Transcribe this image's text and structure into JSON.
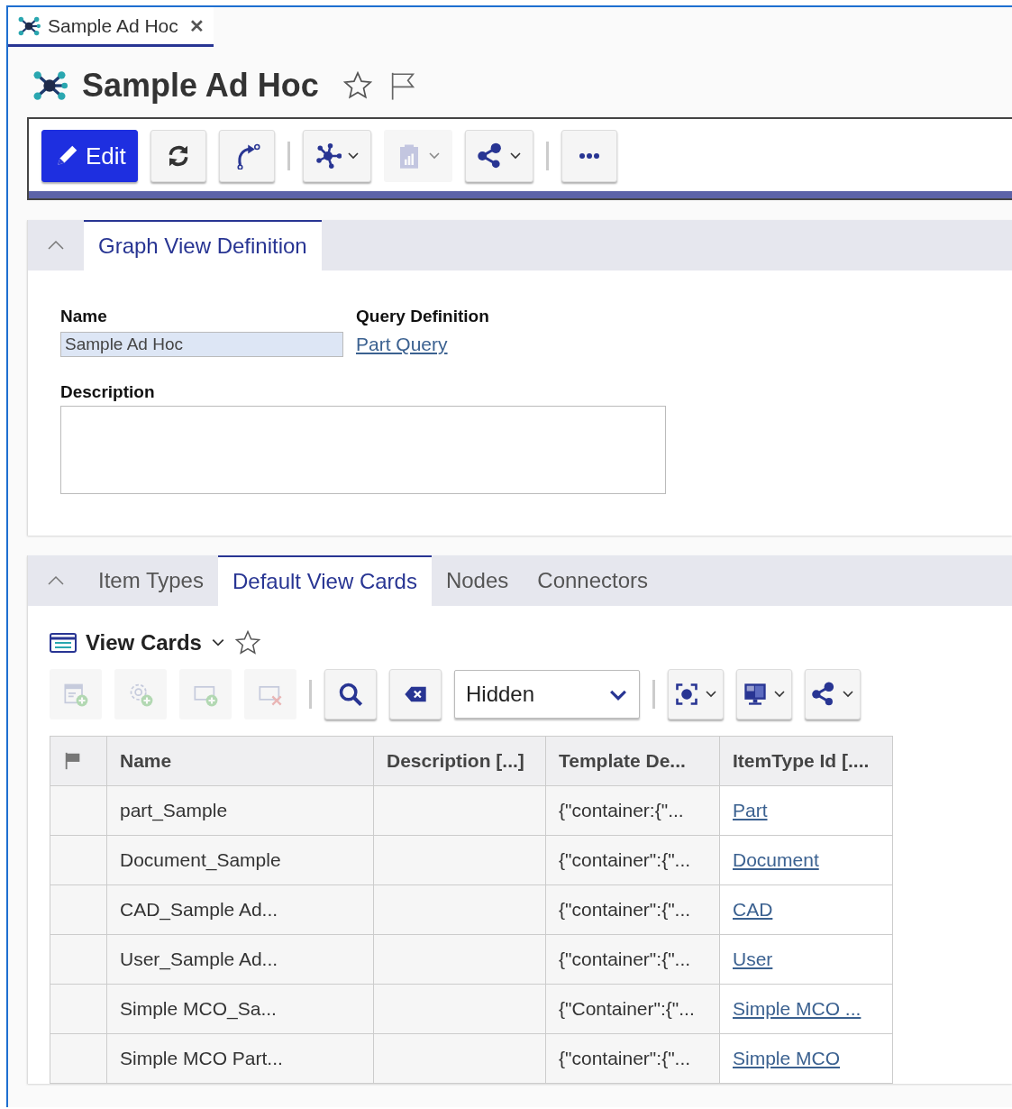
{
  "doc_tab": {
    "label": "Sample Ad Hoc",
    "close": "✕",
    "selected": true
  },
  "title": "Sample Ad Hoc",
  "toolbar": [
    {
      "kind": "button",
      "label": "Edit",
      "primary": true,
      "disabled": false
    },
    {
      "kind": "button",
      "primary": false,
      "disabled": false
    },
    {
      "kind": "button",
      "primary": false,
      "disabled": false
    },
    {
      "kind": "separator"
    },
    {
      "kind": "menu",
      "primary": false,
      "disabled": false
    },
    {
      "kind": "menu",
      "primary": false,
      "disabled": true
    },
    {
      "kind": "menu",
      "primary": false,
      "disabled": false
    },
    {
      "kind": "separator"
    },
    {
      "kind": "button",
      "primary": false,
      "disabled": false
    }
  ],
  "section1": {
    "expanded": true,
    "tabs": [
      {
        "label": "Graph View Definition",
        "selected": true
      }
    ],
    "fields": {
      "name_label": "Name",
      "name_value": "Sample Ad Hoc",
      "query_label": "Query Definition",
      "query_link": "Part Query",
      "description_label": "Description"
    }
  },
  "section2": {
    "expanded": true,
    "tabs": [
      {
        "label": "Item Types",
        "selected": false
      },
      {
        "label": "Default View Cards",
        "selected": true
      },
      {
        "label": "Nodes",
        "selected": false
      },
      {
        "label": "Connectors",
        "selected": false
      }
    ],
    "grid_title": "View Cards",
    "grid_toolbar": [
      {
        "kind": "button",
        "disabled": true
      },
      {
        "kind": "button",
        "disabled": true
      },
      {
        "kind": "button",
        "disabled": true
      },
      {
        "kind": "button",
        "disabled": true
      },
      {
        "kind": "separator"
      },
      {
        "kind": "button",
        "disabled": false
      },
      {
        "kind": "button",
        "disabled": false
      },
      {
        "kind": "select",
        "value": "Hidden",
        "disabled": false
      },
      {
        "kind": "separator"
      },
      {
        "kind": "menu",
        "disabled": false
      },
      {
        "kind": "menu",
        "disabled": false
      },
      {
        "kind": "menu",
        "disabled": false
      }
    ],
    "table": {
      "columns": [
        "Name",
        "Description [...]",
        "Template De...",
        "ItemType Id [...."
      ],
      "rows": [
        {
          "name": "part_Sample",
          "template": "{\"container:{\"...",
          "item_type": "Part"
        },
        {
          "name": "Document_Sample",
          "template": "{\"container\":{\"...",
          "item_type": "Document"
        },
        {
          "name": "CAD_Sample Ad...",
          "template": "{\"container\":{\"...",
          "item_type": "CAD"
        },
        {
          "name": "User_Sample Ad...",
          "template": "{\"container\":{\"...",
          "item_type": "User"
        },
        {
          "name": "Simple MCO_Sa...",
          "template": "{\"Container\":{\"...",
          "item_type": "Simple MCO ..."
        },
        {
          "name": "Simple MCO Part...",
          "template": "{\"container\":{\"...",
          "item_type": "Simple MCO"
        }
      ]
    }
  }
}
